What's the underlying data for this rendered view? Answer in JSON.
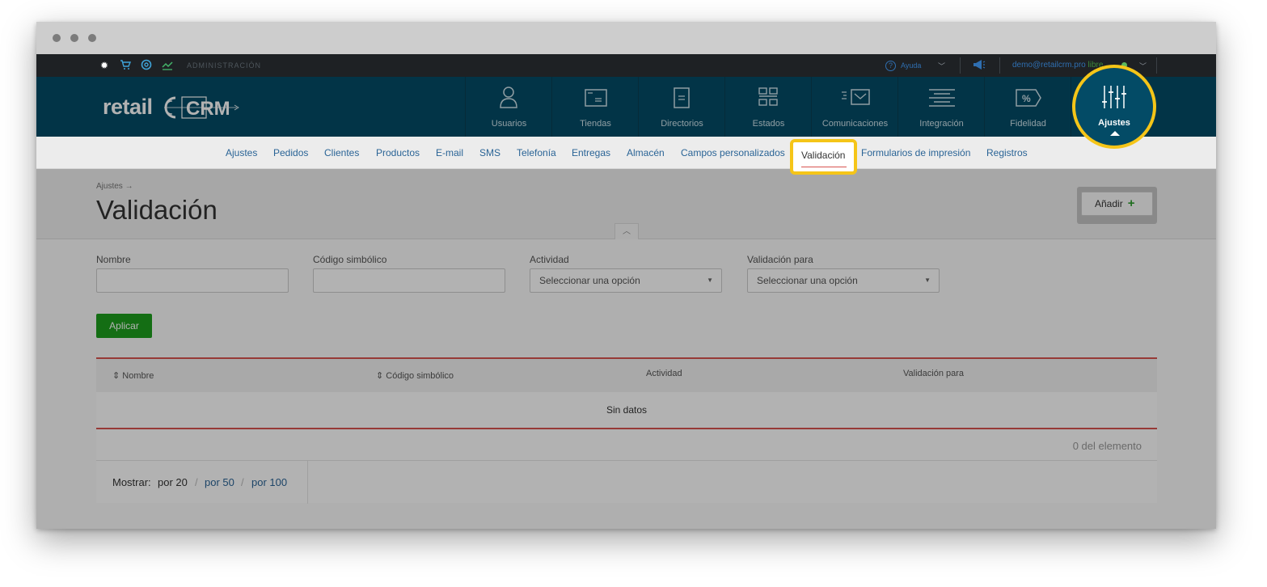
{
  "topbar": {
    "admin_label": "ADMINISTRACIÓN",
    "help_label": "Ayuda",
    "user_email": "demo@retailcrm.pro",
    "user_status": "libre"
  },
  "logo": {
    "retail": "retail",
    "crm": "CRM"
  },
  "mainnav": [
    {
      "label": "Usuarios",
      "icon": "user-icon"
    },
    {
      "label": "Tiendas",
      "icon": "store-icon"
    },
    {
      "label": "Directorios",
      "icon": "directory-icon"
    },
    {
      "label": "Estados",
      "icon": "statuses-icon"
    },
    {
      "label": "Comunicaciones",
      "icon": "communications-icon"
    },
    {
      "label": "Integración",
      "icon": "integration-icon"
    },
    {
      "label": "Fidelidad",
      "icon": "loyalty-icon"
    },
    {
      "label": "Ajustes",
      "icon": "settings-sliders-icon"
    }
  ],
  "subnav": [
    {
      "label": "Ajustes"
    },
    {
      "label": "Pedidos"
    },
    {
      "label": "Clientes"
    },
    {
      "label": "Productos"
    },
    {
      "label": "E-mail"
    },
    {
      "label": "SMS"
    },
    {
      "label": "Telefonía"
    },
    {
      "label": "Entregas"
    },
    {
      "label": "Almacén"
    },
    {
      "label": "Campos personalizados"
    },
    {
      "label": "Validación"
    },
    {
      "label": "Formularios de impresión"
    },
    {
      "label": "Registros"
    }
  ],
  "page": {
    "breadcrumb": "Ajustes →",
    "title": "Validación",
    "add_label": "Añadir"
  },
  "filters": {
    "name_label": "Nombre",
    "code_label": "Código simbólico",
    "activity_label": "Actividad",
    "activity_value": "Seleccionar una opción",
    "validation_for_label": "Validación para",
    "validation_for_value": "Seleccionar una opción",
    "apply_label": "Aplicar"
  },
  "table": {
    "columns": [
      "Nombre",
      "Código simbólico",
      "Actividad",
      "Validación para"
    ],
    "empty_text": "Sin datos",
    "count_text": "0 del elemento",
    "show_label": "Mostrar:",
    "per_page": [
      "por 20",
      "por 50",
      "por 100"
    ]
  },
  "colors": {
    "header_bg": "#034b66",
    "highlight": "#f5c518",
    "accent_red": "#d9534f",
    "apply_green": "#1e9e1e",
    "link_blue": "#2a6496"
  }
}
